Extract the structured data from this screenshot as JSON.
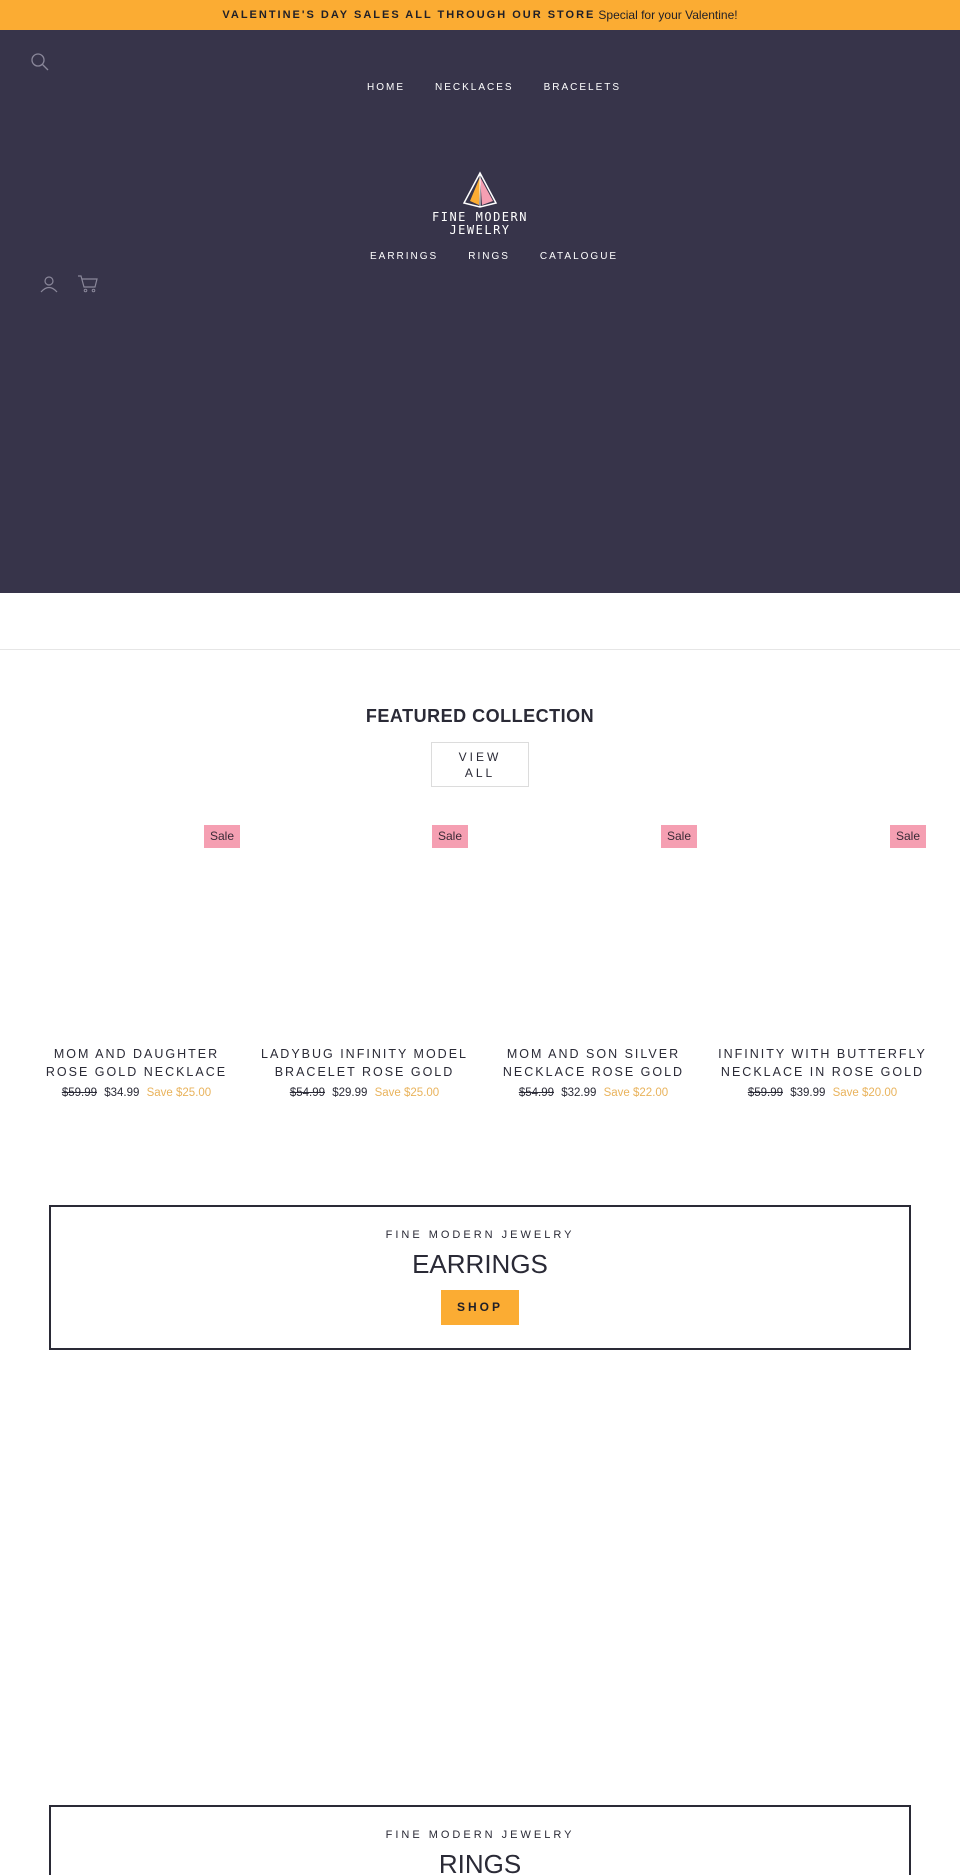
{
  "announcement": {
    "bold_text": "VALENTINE'S DAY SALES ALL THROUGH OUR STORE",
    "sub_text": "Special for your Valentine!",
    "bg_color": "#fbac33"
  },
  "header": {
    "bg_color": "#37344a",
    "nav_top": [
      "HOME",
      "NECKLACES",
      "BRACELETS"
    ],
    "nav_bottom": [
      "EARRINGS",
      "RINGS",
      "CATALOGUE"
    ],
    "logo_line1": "FINE MODERN",
    "logo_line2": "JEWELRY",
    "icons": {
      "search": "search-icon",
      "account": "account-icon",
      "cart": "cart-icon"
    }
  },
  "featured": {
    "title": "FEATURED COLLECTION",
    "view_all_line1": "VIEW",
    "view_all_line2": "ALL",
    "products": [
      {
        "badge": "Sale",
        "name_line1": "MOM AND DAUGHTER",
        "name_line2": "ROSE GOLD NECKLACE",
        "old_price": "$59.99",
        "price": "$34.99",
        "save": "Save $25.00"
      },
      {
        "badge": "Sale",
        "name_line1": "LADYBUG INFINITY MODEL",
        "name_line2": "BRACELET ROSE GOLD",
        "old_price": "$54.99",
        "price": "$29.99",
        "save": "Save $25.00"
      },
      {
        "badge": "Sale",
        "name_line1": "MOM AND SON SILVER",
        "name_line2": "NECKLACE ROSE GOLD",
        "old_price": "$54.99",
        "price": "$32.99",
        "save": "Save $22.00"
      },
      {
        "badge": "Sale",
        "name_line1": "INFINITY WITH BUTTERFLY",
        "name_line2": "NECKLACE IN ROSE GOLD",
        "old_price": "$59.99",
        "price": "$39.99",
        "save": "Save $20.00"
      }
    ]
  },
  "promo_earrings": {
    "kicker": "FINE MODERN JEWELRY",
    "heading": "EARRINGS",
    "button": "SHOP"
  },
  "promo_rings": {
    "kicker": "FINE MODERN JEWELRY",
    "heading": "RINGS"
  },
  "colors": {
    "accent": "#fbac33",
    "sale_badge": "#f59fb2",
    "save_text": "#e9b35c"
  }
}
